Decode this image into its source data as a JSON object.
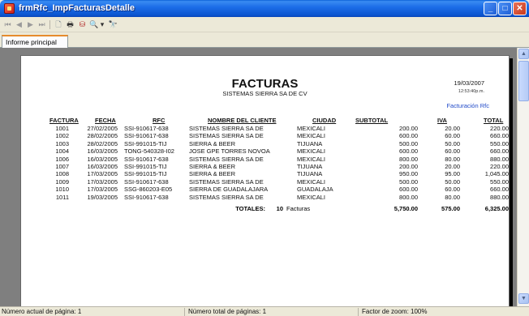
{
  "window": {
    "title": "frmRfc_ImpFacturasDetalle",
    "min_glyph": "_",
    "max_glyph": "□",
    "close_glyph": "✕"
  },
  "toolbar": {
    "first_icon": "first-page-icon",
    "prev_icon": "previous-page-icon",
    "next_icon": "next-page-icon",
    "last_icon": "last-page-icon",
    "glyphs": {
      "first": "⏮",
      "prev": "◀",
      "next": "▶",
      "last": "⏭",
      "export": "🗋",
      "print": "🖶",
      "layout": "⛁",
      "zoom": "🔍",
      "dropdown": "▾",
      "find": "🔭"
    }
  },
  "tabs": [
    {
      "label": "Informe principal"
    }
  ],
  "report": {
    "title": "FACTURAS",
    "company": "SISTEMAS SIERRA SA DE CV",
    "date": "19/03/2007",
    "time": "12:53:40p.m.",
    "subtitle_link": "Facturación Rfc",
    "columns": {
      "factura": "FACTURA",
      "fecha": "FECHA",
      "rfc": "RFC",
      "nombre": "NOMBRE DEL CLIENTE",
      "ciudad": "CIUDAD",
      "subtotal": "SUBTOTAL",
      "iva": "IVA",
      "total": "TOTAL"
    },
    "rows": [
      [
        "1001",
        "27/02/2005",
        "SSI-910617-638",
        "SISTEMAS SIERRA SA DE",
        "MEXICALI",
        "200.00",
        "20.00",
        "220.00"
      ],
      [
        "1002",
        "28/02/2005",
        "SSI-910617-638",
        "SISTEMAS SIERRA SA DE",
        "MEXICALI",
        "600.00",
        "60.00",
        "660.00"
      ],
      [
        "1003",
        "28/02/2005",
        "SSI-991015-TIJ",
        "SIERRA & BEER",
        "TIJUANA",
        "500.00",
        "50.00",
        "550.00"
      ],
      [
        "1004",
        "16/03/2005",
        "TONG-540328-I02",
        "JOSE GPE TORRES NOVOA",
        "MEXICALI",
        "600.00",
        "60.00",
        "660.00"
      ],
      [
        "1006",
        "16/03/2005",
        "SSI-910617-638",
        "SISTEMAS SIERRA SA DE",
        "MEXICALI",
        "800.00",
        "80.00",
        "880.00"
      ],
      [
        "1007",
        "16/03/2005",
        "SSI-991015-TIJ",
        "SIERRA & BEER",
        "TIJUANA",
        "200.00",
        "20.00",
        "220.00"
      ],
      [
        "1008",
        "17/03/2005",
        "SSI-991015-TIJ",
        "SIERRA & BEER",
        "TIJUANA",
        "950.00",
        "95.00",
        "1,045.00"
      ],
      [
        "1009",
        "17/03/2005",
        "SSI-910617-638",
        "SISTEMAS SIERRA SA DE",
        "MEXICALI",
        "500.00",
        "50.00",
        "550.00"
      ],
      [
        "1010",
        "17/03/2005",
        "SSG-860203-E05",
        "SIERRA DE GUADALAJARA",
        "GUADALAJA",
        "600.00",
        "60.00",
        "660.00"
      ],
      [
        "1011",
        "19/03/2005",
        "SSI-910617-638",
        "SISTEMAS SIERRA SA DE",
        "MEXICALI",
        "800.00",
        "80.00",
        "880.00"
      ]
    ],
    "totals": {
      "label": "TOTALES:",
      "count": "10",
      "count_unit": "Facturas",
      "subtotal": "5,750.00",
      "iva": "575.00",
      "total": "6,325.00"
    }
  },
  "scrollbar": {
    "up_glyph": "▲",
    "down_glyph": "▼"
  },
  "statusbar": {
    "current_page": "Número actual de página: 1",
    "total_pages": "Número total de páginas: 1",
    "zoom": "Factor de zoom: 100%"
  },
  "colors": {
    "titlebar": "#1d6ee8",
    "link": "#1f49c8",
    "tab_accent": "#e68b2c",
    "viewport_bg": "#7f7f7f"
  }
}
